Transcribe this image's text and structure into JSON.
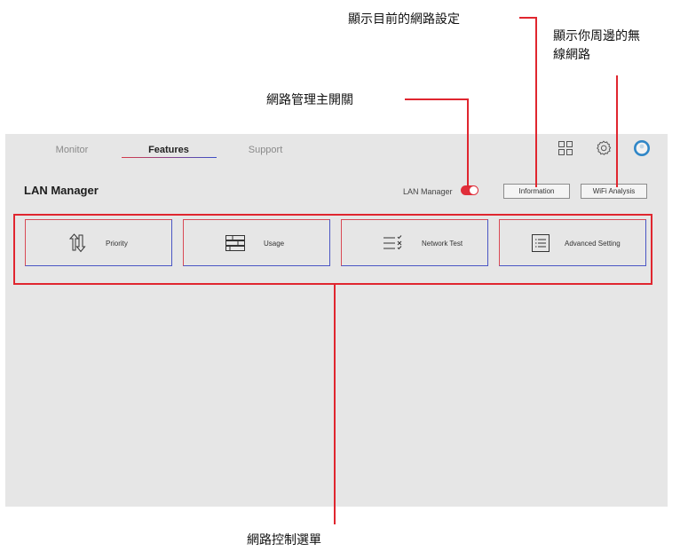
{
  "tabs": [
    {
      "label": "Monitor",
      "active": false
    },
    {
      "label": "Features",
      "active": true
    },
    {
      "label": "Support",
      "active": false
    }
  ],
  "header_icons": [
    "grid-icon",
    "settings-gear-icon",
    "user-avatar-icon"
  ],
  "page_title": "LAN Manager",
  "lan_manager": {
    "label": "LAN Manager",
    "toggle_on": true
  },
  "buttons": {
    "information": "Information",
    "wifi_analysis": "WiFi Analysis"
  },
  "menu_items": [
    {
      "label": "Priority",
      "icon": "up-down-arrows-icon"
    },
    {
      "label": "Usage",
      "icon": "usage-bars-icon"
    },
    {
      "label": "Network Test",
      "icon": "checklist-icon"
    },
    {
      "label": "Advanced Setting",
      "icon": "list-document-icon"
    }
  ],
  "callouts": {
    "network_settings": "顯示目前的網路設定",
    "wireless_nearby_line1": "顯示你周邊的無",
    "wireless_nearby_line2": "線網路",
    "main_switch": "網路管理主開關",
    "control_menu": "網路控制選單"
  },
  "colors": {
    "accent_red": "#e0262f",
    "accent_blue": "#4a56c4",
    "panel_bg": "#e6e6e6",
    "avatar_blue": "#2f86c7"
  }
}
